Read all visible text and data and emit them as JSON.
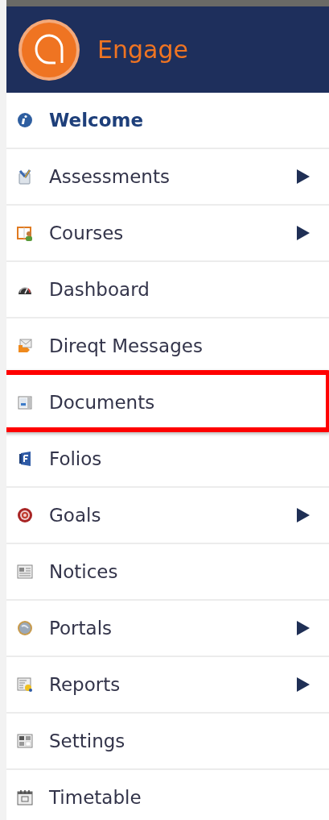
{
  "header": {
    "app_name": "Engage"
  },
  "menu": [
    {
      "label": "Welcome",
      "selected": true,
      "has_submenu": false,
      "highlighted": false
    },
    {
      "label": "Assessments",
      "selected": false,
      "has_submenu": true,
      "highlighted": false
    },
    {
      "label": "Courses",
      "selected": false,
      "has_submenu": true,
      "highlighted": false
    },
    {
      "label": "Dashboard",
      "selected": false,
      "has_submenu": false,
      "highlighted": false
    },
    {
      "label": "Direqt Messages",
      "selected": false,
      "has_submenu": false,
      "highlighted": false
    },
    {
      "label": "Documents",
      "selected": false,
      "has_submenu": false,
      "highlighted": true
    },
    {
      "label": "Folios",
      "selected": false,
      "has_submenu": false,
      "highlighted": false
    },
    {
      "label": "Goals",
      "selected": false,
      "has_submenu": true,
      "highlighted": false
    },
    {
      "label": "Notices",
      "selected": false,
      "has_submenu": false,
      "highlighted": false
    },
    {
      "label": "Portals",
      "selected": false,
      "has_submenu": true,
      "highlighted": false
    },
    {
      "label": "Reports",
      "selected": false,
      "has_submenu": true,
      "highlighted": false
    },
    {
      "label": "Settings",
      "selected": false,
      "has_submenu": false,
      "highlighted": false
    },
    {
      "label": "Timetable",
      "selected": false,
      "has_submenu": false,
      "highlighted": false
    }
  ]
}
